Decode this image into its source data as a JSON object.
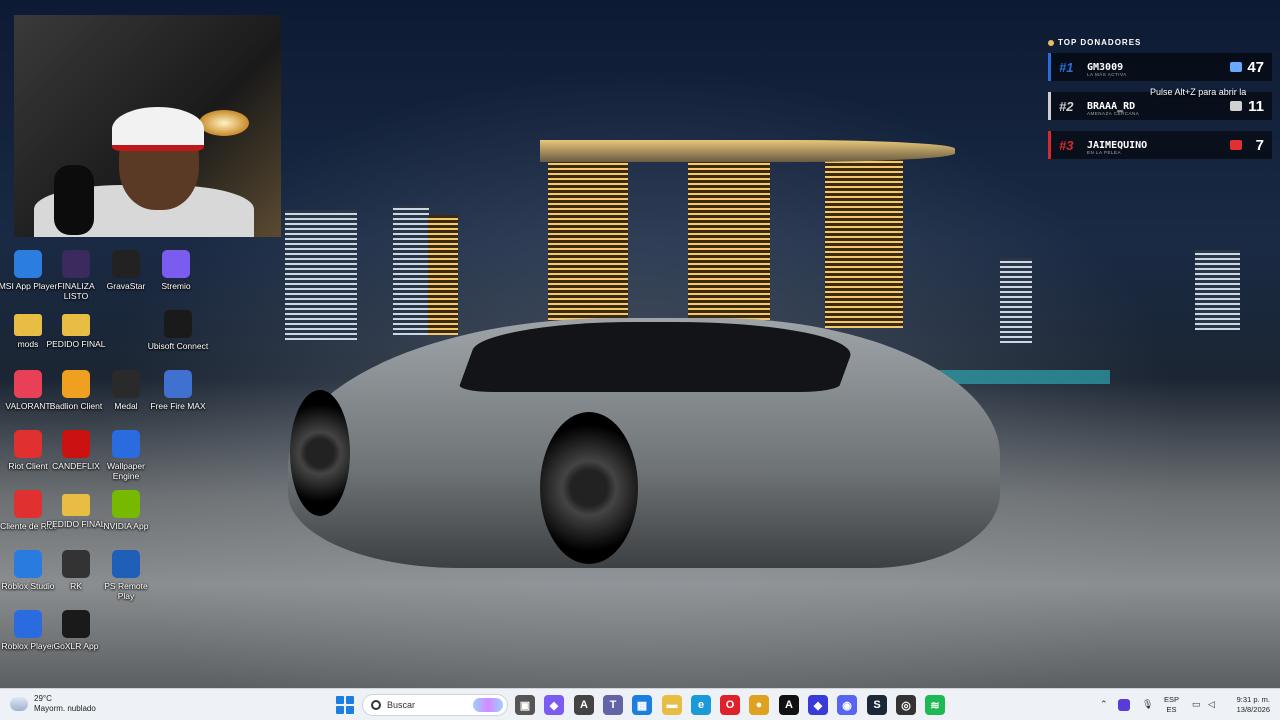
{
  "desktop": {
    "icons": [
      {
        "label": "MSI App Player",
        "icon": "msi-icon",
        "color": "#2b7de0"
      },
      {
        "label": "FINALIZA LISTO",
        "icon": "video-thumbnail-icon",
        "color": "#3a2a5e"
      },
      {
        "label": "GravaStar",
        "icon": "gravastar-icon",
        "color": "#222222"
      },
      {
        "label": "Stremio",
        "icon": "stremio-icon",
        "color": "#7b5cf0"
      },
      {
        "label": "mods",
        "icon": "folder-icon",
        "color": "#e8bd44"
      },
      {
        "label": "PEDIDO FINAL",
        "icon": "folder-icon",
        "color": "#e8bd44"
      },
      {
        "label": "Ubisoft Connect",
        "icon": "ubisoft-icon",
        "color": "#1a1a1a"
      },
      {
        "label": "VALORANT",
        "icon": "valorant-icon",
        "color": "#e84057"
      },
      {
        "label": "Badlion Client",
        "icon": "badlion-icon",
        "color": "#f0a020"
      },
      {
        "label": "Medal",
        "icon": "medal-icon",
        "color": "#2a2a2a"
      },
      {
        "label": "Free Fire MAX",
        "icon": "free-fire-icon",
        "color": "#4070d0"
      },
      {
        "label": "Riot Client",
        "icon": "riot-icon",
        "color": "#e03030"
      },
      {
        "label": "CANDEFLIX",
        "icon": "candeflix-icon",
        "color": "#cc1111"
      },
      {
        "label": "Wallpaper Engine",
        "icon": "wallpaper-engine-icon",
        "color": "#2a6be0"
      },
      {
        "label": "Cliente de Riot",
        "icon": "riot-icon",
        "color": "#e03030"
      },
      {
        "label": "PEDIDO FINAL",
        "icon": "folder-icon",
        "color": "#e8bd44"
      },
      {
        "label": "NVIDIA App",
        "icon": "nvidia-icon",
        "color": "#76b900"
      },
      {
        "label": "Roblox Studio",
        "icon": "roblox-studio-icon",
        "color": "#2a7be0"
      },
      {
        "label": "RK",
        "icon": "rk-icon",
        "color": "#333333"
      },
      {
        "label": "PS Remote Play",
        "icon": "ps-remote-icon",
        "color": "#1f5fb8"
      },
      {
        "label": "Roblox Player",
        "icon": "roblox-icon",
        "color": "#2a6be0"
      },
      {
        "label": "GoXLR App",
        "icon": "goxlr-icon",
        "color": "#1a1a1a"
      }
    ]
  },
  "donors": {
    "title": "TOP DONADORES",
    "entries": [
      {
        "rank": "#1",
        "name": "GM3009",
        "sub": "LA MÁS ACTIVA",
        "amount": "47",
        "accent": "#2a6ce0",
        "gift_color": "#6aa8ff"
      },
      {
        "rank": "#2",
        "name": "BRAAA_RD",
        "sub": "AMENAZA CERCANA",
        "amount": "11",
        "accent": "#cfcfcf",
        "gift_color": "#d0d0d0"
      },
      {
        "rank": "#3",
        "name": "JAIMEQUINO",
        "sub": "EN LA PELEA",
        "amount": "7",
        "accent": "#d82a2a",
        "gift_color": "#e03030"
      }
    ],
    "hint": "Pulse Alt+Z para abrir la"
  },
  "taskbar": {
    "weather": {
      "temp": "29°C",
      "condition": "Mayorm. nublado"
    },
    "search_placeholder": "Buscar",
    "language": {
      "line1": "ESP",
      "line2": "ES"
    },
    "clock": {
      "time": "9:31 p. m.",
      "date": "13/8/2026"
    },
    "apps": [
      {
        "name": "task-view-icon",
        "glyph": "▣",
        "color": "#555555"
      },
      {
        "name": "copilot-icon",
        "glyph": "◆",
        "color": "#7b5cf0"
      },
      {
        "name": "widgets-icon",
        "glyph": "A",
        "color": "#444444"
      },
      {
        "name": "teams-icon",
        "glyph": "T",
        "color": "#6264a7"
      },
      {
        "name": "store-icon",
        "glyph": "▦",
        "color": "#1a7fe0"
      },
      {
        "name": "file-explorer-icon",
        "glyph": "▬",
        "color": "#e8bd44"
      },
      {
        "name": "edge-icon",
        "glyph": "e",
        "color": "#1a9ad8"
      },
      {
        "name": "opera-icon",
        "glyph": "O",
        "color": "#e0202a"
      },
      {
        "name": "chrome-icon",
        "glyph": "●",
        "color": "#e0a020"
      },
      {
        "name": "nvidia-app-icon",
        "glyph": "A",
        "color": "#111111"
      },
      {
        "name": "kick-icon",
        "glyph": "◆",
        "color": "#3a3ad8"
      },
      {
        "name": "discord-icon",
        "glyph": "◉",
        "color": "#5865f2"
      },
      {
        "name": "steam-icon",
        "glyph": "S",
        "color": "#1b2838"
      },
      {
        "name": "obs-icon",
        "glyph": "◎",
        "color": "#333333"
      },
      {
        "name": "spotify-icon",
        "glyph": "≋",
        "color": "#1db954"
      }
    ]
  }
}
